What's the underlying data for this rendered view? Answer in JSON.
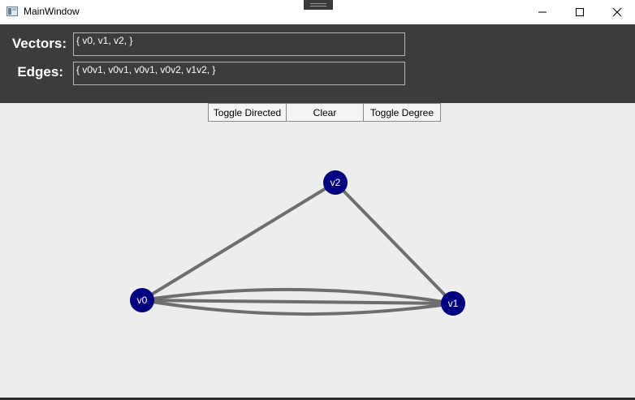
{
  "window": {
    "title": "MainWindow"
  },
  "header": {
    "vectors_label": "Vectors:",
    "vectors_value": "{ v0, v1, v2, }",
    "edges_label": "Edges:",
    "edges_value": "{ v0v1, v0v1, v0v1, v0v2, v1v2, }"
  },
  "toolbar": {
    "toggle_directed": "Toggle Directed",
    "clear": "Clear",
    "toggle_degree": "Toggle Degree"
  },
  "graph": {
    "vertex_color": "#000080",
    "edge_color": "#6e6e6e",
    "vertices": [
      {
        "id": "v0",
        "label": "v0"
      },
      {
        "id": "v1",
        "label": "v1"
      },
      {
        "id": "v2",
        "label": "v2"
      }
    ],
    "edges": [
      {
        "from": "v0",
        "to": "v1"
      },
      {
        "from": "v0",
        "to": "v1"
      },
      {
        "from": "v0",
        "to": "v1"
      },
      {
        "from": "v0",
        "to": "v2"
      },
      {
        "from": "v1",
        "to": "v2"
      }
    ]
  }
}
